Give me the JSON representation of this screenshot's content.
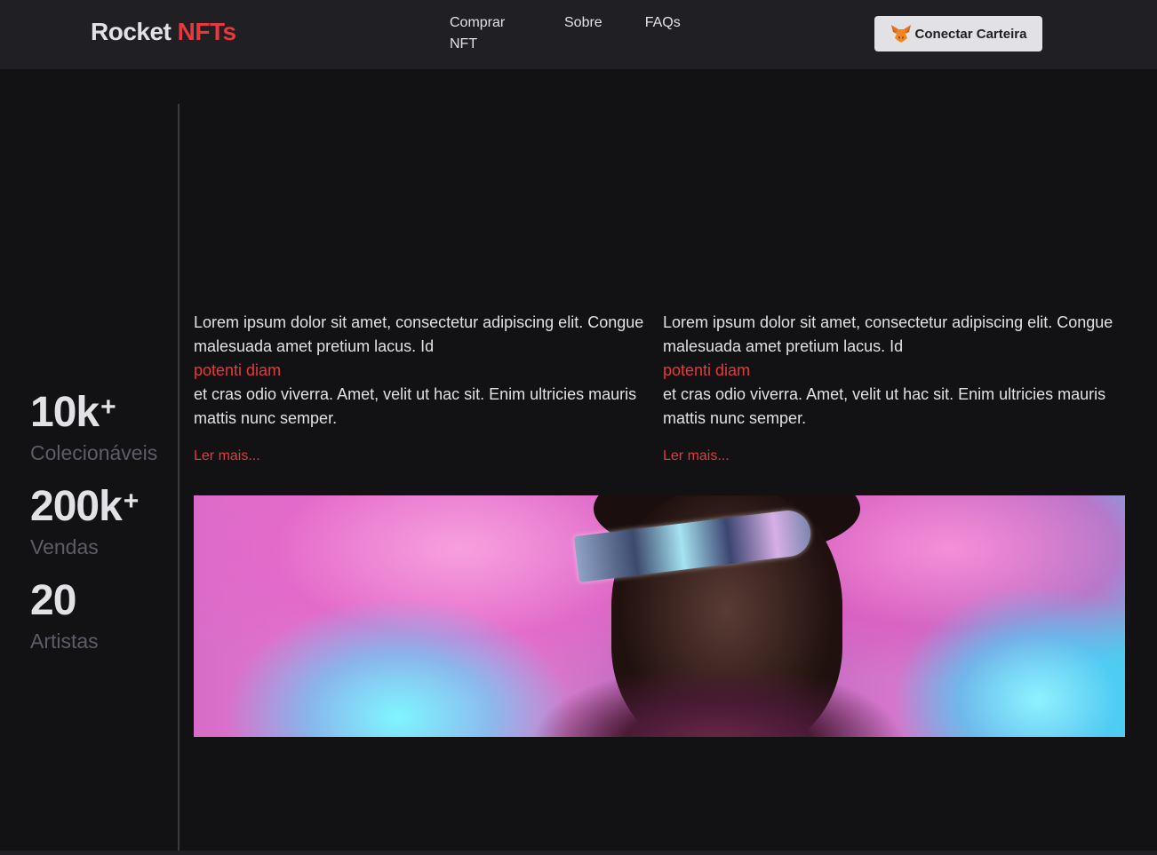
{
  "header": {
    "logo_main": "Rocket",
    "logo_accent": "NFTs",
    "nav": [
      {
        "label": "Comprar NFT"
      },
      {
        "label": "Sobre"
      },
      {
        "label": "FAQs"
      }
    ],
    "wallet_button": "Conectar Carteira"
  },
  "stats": [
    {
      "value": "10k",
      "suffix": "+",
      "label": "Colecionáveis"
    },
    {
      "value": "200k",
      "suffix": "+",
      "label": "Vendas"
    },
    {
      "value": "20",
      "suffix": "",
      "label": "Artistas"
    }
  ],
  "articles": [
    {
      "text_before": "Lorem ipsum dolor sit amet, consectetur adipiscing elit. Congue malesuada amet pretium lacus. Id",
      "highlight": "potenti diam",
      "text_after": "et cras odio viverra. Amet, velit ut hac sit. Enim ultricies mauris mattis nunc semper.",
      "read_more": "Ler mais..."
    },
    {
      "text_before": "Lorem ipsum dolor sit amet, consectetur adipiscing elit. Congue malesuada amet pretium lacus. Id",
      "highlight": "potenti diam",
      "text_after": "et cras odio viverra. Amet, velit ut hac sit. Enim ultricies mauris mattis nunc semper.",
      "read_more": "Ler mais..."
    }
  ],
  "colors": {
    "accent": "#e5393d",
    "background": "#121214",
    "header_bg": "#202024",
    "text": "#e1e1e6",
    "muted": "#5d5d68"
  },
  "icons": {
    "wallet": "metamask-fox-icon"
  }
}
